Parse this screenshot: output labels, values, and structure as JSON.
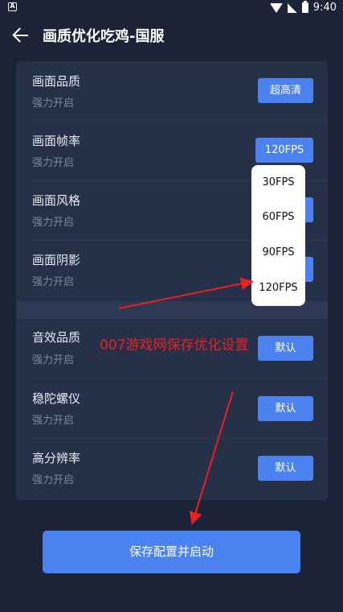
{
  "status_bar": {
    "time": "9:40",
    "app_badge": "A"
  },
  "header": {
    "title": "画质优化吃鸡-国服"
  },
  "settings": [
    {
      "title": "画面品质",
      "subtitle": "强力开启",
      "button": "超高清"
    },
    {
      "title": "画面帧率",
      "subtitle": "强力开启",
      "button": "120FPS"
    },
    {
      "title": "画面风格",
      "subtitle": "强力开启",
      "button": ""
    },
    {
      "title": "画面阴影",
      "subtitle": "强力开启",
      "button": ""
    },
    {
      "title": "音效品质",
      "subtitle": "强力开启",
      "button": "默认"
    },
    {
      "title": "稳陀螺仪",
      "subtitle": "强力开启",
      "button": "默认"
    },
    {
      "title": "高分辨率",
      "subtitle": "强力开启",
      "button": "默认"
    }
  ],
  "fps_dropdown": {
    "options": [
      "30FPS",
      "60FPS",
      "90FPS",
      "120FPS"
    ]
  },
  "watermark": "007游戏网保存优化设置",
  "save_button": "保存配置并启动",
  "colors": {
    "background": "#1b2336",
    "panel": "#263049",
    "accent": "#4c82f0",
    "annotation": "#e82020"
  }
}
